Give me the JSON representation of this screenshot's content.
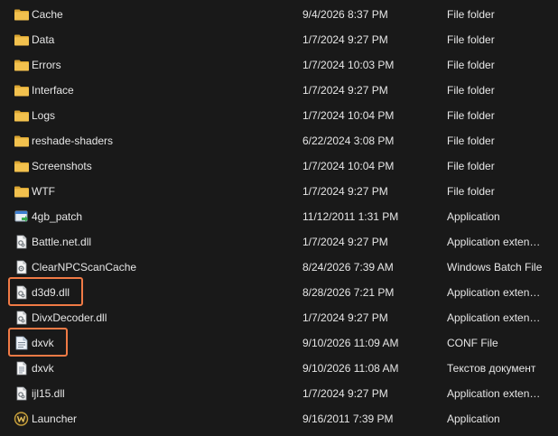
{
  "files": [
    {
      "name": "Cache",
      "date": "9/4/2026 8:37 PM",
      "type": "File folder",
      "icon": "folder"
    },
    {
      "name": "Data",
      "date": "1/7/2024 9:27 PM",
      "type": "File folder",
      "icon": "folder"
    },
    {
      "name": "Errors",
      "date": "1/7/2024 10:03 PM",
      "type": "File folder",
      "icon": "folder"
    },
    {
      "name": "Interface",
      "date": "1/7/2024 9:27 PM",
      "type": "File folder",
      "icon": "folder"
    },
    {
      "name": "Logs",
      "date": "1/7/2024 10:04 PM",
      "type": "File folder",
      "icon": "folder"
    },
    {
      "name": "reshade-shaders",
      "date": "6/22/2024 3:08 PM",
      "type": "File folder",
      "icon": "folder"
    },
    {
      "name": "Screenshots",
      "date": "1/7/2024 10:04 PM",
      "type": "File folder",
      "icon": "folder"
    },
    {
      "name": "WTF",
      "date": "1/7/2024 9:27 PM",
      "type": "File folder",
      "icon": "folder"
    },
    {
      "name": "4gb_patch",
      "date": "11/12/2011 1:31 PM",
      "type": "Application",
      "icon": "application"
    },
    {
      "name": "Battle.net.dll",
      "date": "1/7/2024 9:27 PM",
      "type": "Application extension",
      "icon": "dll"
    },
    {
      "name": "ClearNPCScanCache",
      "date": "8/24/2026 7:39 AM",
      "type": "Windows Batch File",
      "icon": "batch"
    },
    {
      "name": "d3d9.dll",
      "date": "8/28/2026 7:21 PM",
      "type": "Application extension",
      "icon": "dll"
    },
    {
      "name": "DivxDecoder.dll",
      "date": "1/7/2024 9:27 PM",
      "type": "Application extension",
      "icon": "dll"
    },
    {
      "name": "dxvk",
      "date": "9/10/2026 11:09 AM",
      "type": "CONF File",
      "icon": "conf"
    },
    {
      "name": "dxvk",
      "date": "9/10/2026 11:08 AM",
      "type": "Текстов документ",
      "icon": "text"
    },
    {
      "name": "ijl15.dll",
      "date": "1/7/2024 9:27 PM",
      "type": "Application extension",
      "icon": "dll"
    },
    {
      "name": "Launcher",
      "date": "9/16/2011 7:39 PM",
      "type": "Application",
      "icon": "launcher"
    }
  ],
  "highlight_color": "#f07a45",
  "folder_color": "#f2c14e"
}
